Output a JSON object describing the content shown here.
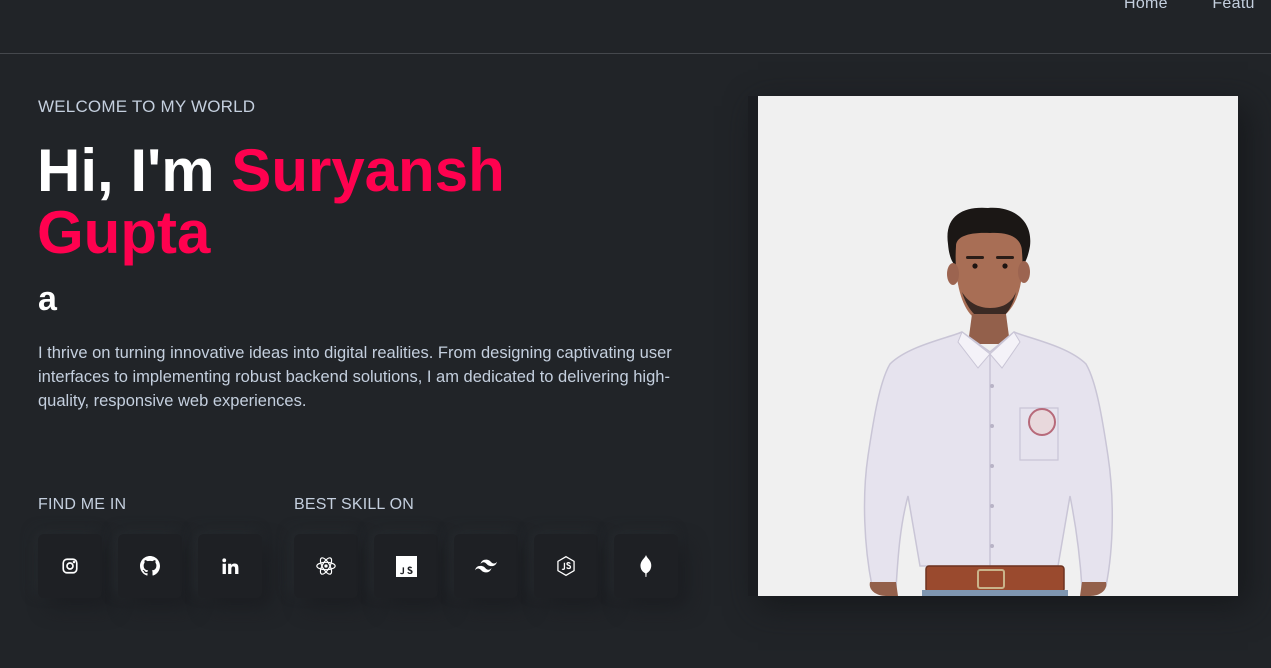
{
  "nav": {
    "items": [
      "Home",
      "Featu"
    ]
  },
  "hero": {
    "welcome": "WELCOME TO MY WORLD",
    "greeting": "Hi, I'm ",
    "name_first": "Suryansh",
    "name_last": "Gupta",
    "typed_text": "a",
    "description": "I thrive on turning innovative ideas into digital realities. From designing captivating user interfaces to implementing robust backend solutions, I am dedicated to delivering high-quality, responsive web experiences."
  },
  "social": {
    "label": "FIND ME IN",
    "icons": [
      "instagram-icon",
      "github-icon",
      "linkedin-icon"
    ]
  },
  "skills": {
    "label": "BEST SKILL ON",
    "icons": [
      "react-icon",
      "javascript-icon",
      "tailwind-icon",
      "nodejs-icon",
      "mongodb-icon"
    ]
  },
  "colors": {
    "background": "#212428",
    "accent": "#ff014f",
    "text": "#c4cfde",
    "heading": "#ffffff",
    "card": "#1e2024",
    "photo_background": "#f0f0f0"
  }
}
